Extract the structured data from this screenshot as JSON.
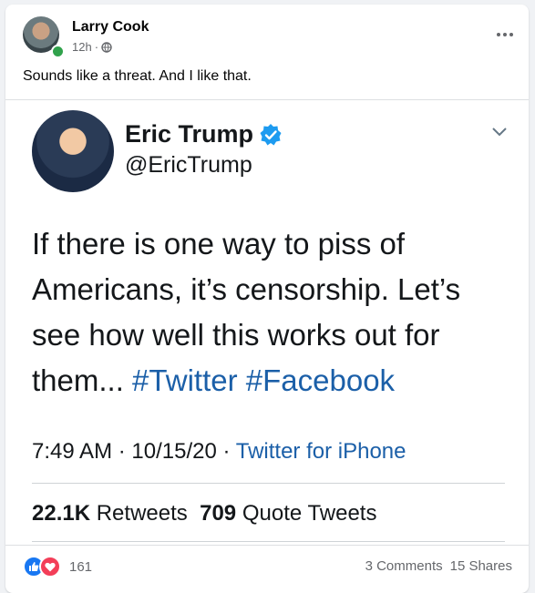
{
  "post": {
    "author": "Larry Cook",
    "time": "12h",
    "separator": "·",
    "privacy_icon": "globe-icon",
    "text": "Sounds like a threat. And I like that."
  },
  "tweet": {
    "name": "Eric Trump",
    "handle": "@EricTrump",
    "body_line1": "If there is one way to piss of",
    "body_line2": "Americans, it’s censorship. Let’s",
    "body_line3": "see how well this works out for",
    "body_line4_text": "them...",
    "hashtag1": "#Twitter",
    "hashtag2": "#Facebook",
    "time": "7:49 AM",
    "date": "10/15/20",
    "separator": "·",
    "source": "Twitter for iPhone",
    "retweets_count": "22.1K",
    "retweets_label": "Retweets",
    "quotes_count": "709",
    "quotes_label": "Quote Tweets"
  },
  "footer": {
    "reaction_count": "161",
    "comments": "3 Comments",
    "shares": "15 Shares"
  },
  "colors": {
    "link_blue": "#1b5fa8",
    "verified_blue": "#1d9bf0",
    "like_blue": "#1877f2",
    "love_red": "#f33e58",
    "online_green": "#31a24c"
  }
}
